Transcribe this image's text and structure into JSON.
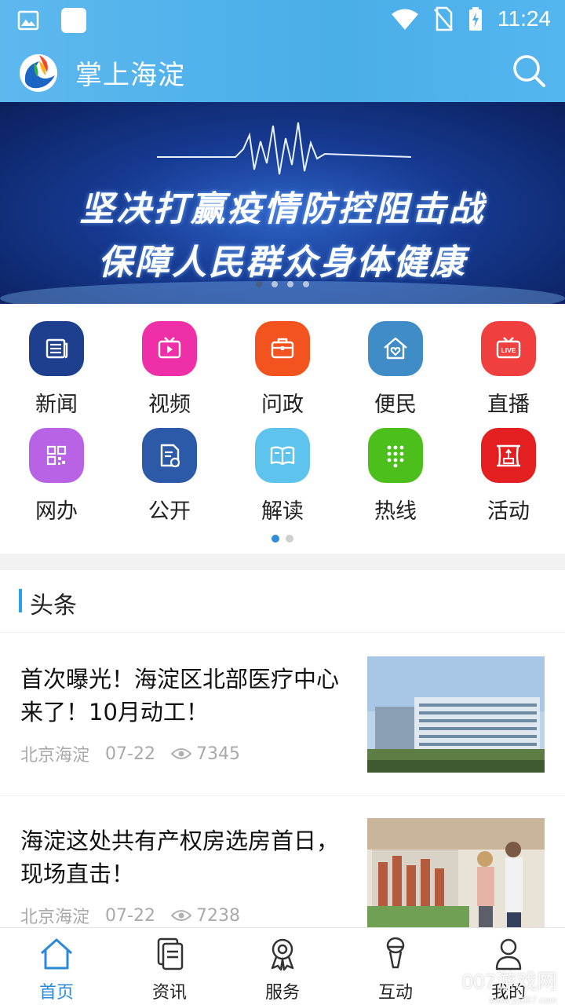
{
  "status_bar": {
    "time": "11:24"
  },
  "app": {
    "title": "掌上海淀"
  },
  "banner": {
    "line1": "坚决打赢疫情防控阻击战",
    "line2": "保障人民群众身体健康",
    "page_count": 4,
    "active_page": 1
  },
  "grid": {
    "items": [
      {
        "label": "新闻",
        "icon": "newspaper-icon",
        "color": "#1e3f8e"
      },
      {
        "label": "视频",
        "icon": "tv-icon",
        "color": "#ee2fa8"
      },
      {
        "label": "问政",
        "icon": "briefcase-icon",
        "color": "#f2531f"
      },
      {
        "label": "便民",
        "icon": "home-heart-icon",
        "color": "#3f8cc7"
      },
      {
        "label": "直播",
        "icon": "live-tv-icon",
        "color": "#ef3f3f"
      },
      {
        "label": "网办",
        "icon": "qr-code-icon",
        "color": "#b863e6"
      },
      {
        "label": "公开",
        "icon": "document-icon",
        "color": "#2c5aa8"
      },
      {
        "label": "解读",
        "icon": "open-book-icon",
        "color": "#5ec4ee"
      },
      {
        "label": "热线",
        "icon": "dialpad-icon",
        "color": "#4cbf1c"
      },
      {
        "label": "活动",
        "icon": "stage-icon",
        "color": "#e41f1f"
      }
    ],
    "page_count": 2,
    "active_page": 1
  },
  "headlines": {
    "title": "头条",
    "items": [
      {
        "title": "首次曝光！海淀区北部医疗中心来了！10月动工！",
        "source": "北京海淀",
        "date": "07-22",
        "views": "7345",
        "thumb": "hospital-building-image"
      },
      {
        "title": "海淀这处共有产权房选房首日，现场直击！",
        "source": "北京海淀",
        "date": "07-22",
        "views": "7238",
        "thumb": "housing-model-image"
      }
    ]
  },
  "tabbar": {
    "items": [
      {
        "label": "首页",
        "icon": "home-icon"
      },
      {
        "label": "资讯",
        "icon": "documents-icon"
      },
      {
        "label": "服务",
        "icon": "award-icon"
      },
      {
        "label": "互动",
        "icon": "microphone-icon"
      },
      {
        "label": "我的",
        "icon": "user-icon"
      }
    ],
    "active": 0
  },
  "watermark": "007游戏网",
  "watermark_sub": "www.yx007.com",
  "colors": {
    "accent": "#2a8ad8",
    "topbar": "#4aaee9"
  }
}
